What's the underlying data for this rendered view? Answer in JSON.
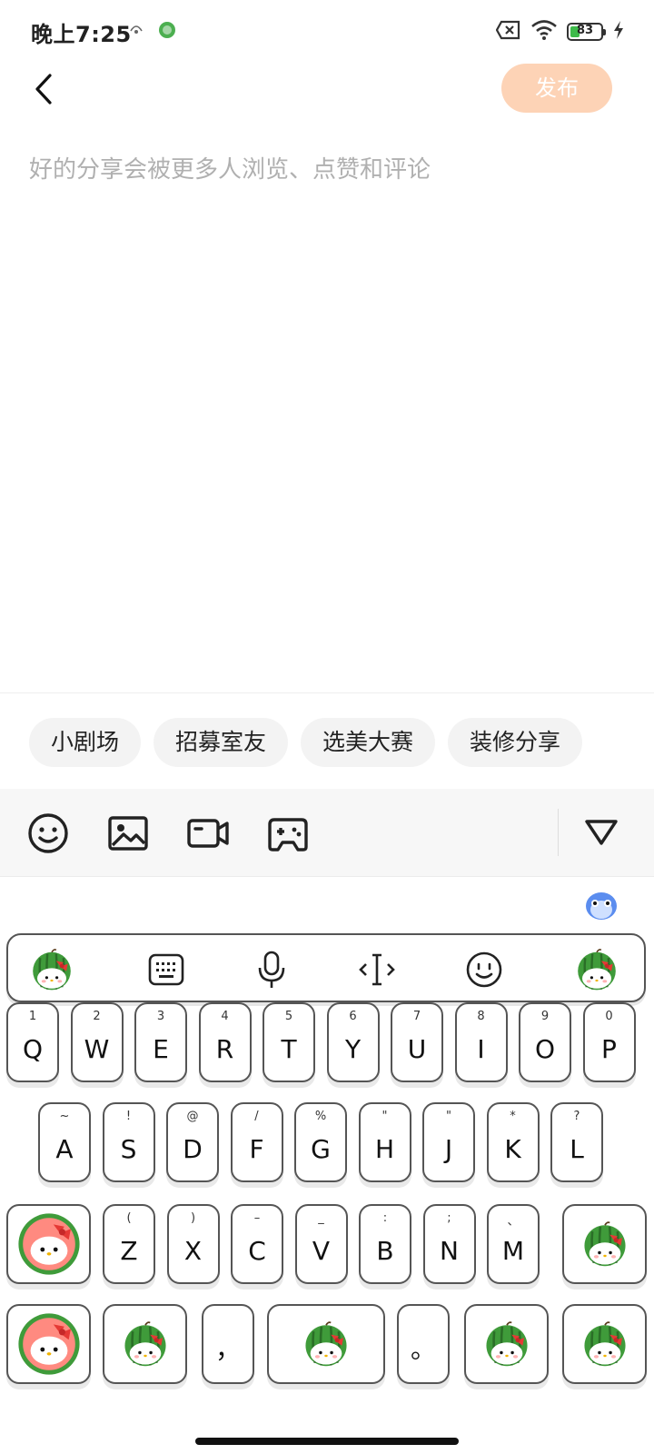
{
  "status_bar": {
    "time": "晚上7:25",
    "battery": "83"
  },
  "header": {
    "publish_label": "发布"
  },
  "editor": {
    "placeholder": "好的分享会被更多人浏览、点赞和评论"
  },
  "topics": [
    "小剧场",
    "招募室友",
    "选美大赛",
    "装修分享"
  ],
  "toolbar": {
    "icons": [
      "emoji-icon",
      "image-icon",
      "video-icon",
      "game-icon",
      "collapse-icon"
    ]
  },
  "keyboard": {
    "row1": [
      {
        "key": "Q",
        "hint": "1"
      },
      {
        "key": "W",
        "hint": "2"
      },
      {
        "key": "E",
        "hint": "3"
      },
      {
        "key": "R",
        "hint": "4"
      },
      {
        "key": "T",
        "hint": "5"
      },
      {
        "key": "Y",
        "hint": "6"
      },
      {
        "key": "U",
        "hint": "7"
      },
      {
        "key": "I",
        "hint": "8"
      },
      {
        "key": "O",
        "hint": "9"
      },
      {
        "key": "P",
        "hint": "0"
      }
    ],
    "row2": [
      {
        "key": "A",
        "hint": "~"
      },
      {
        "key": "S",
        "hint": "!"
      },
      {
        "key": "D",
        "hint": "@"
      },
      {
        "key": "F",
        "hint": "/"
      },
      {
        "key": "G",
        "hint": "%"
      },
      {
        "key": "H",
        "hint": "\""
      },
      {
        "key": "J",
        "hint": "\""
      },
      {
        "key": "K",
        "hint": "*"
      },
      {
        "key": "L",
        "hint": "?"
      }
    ],
    "row3": [
      {
        "key": "Z",
        "hint": "("
      },
      {
        "key": "X",
        "hint": ")"
      },
      {
        "key": "C",
        "hint": "–"
      },
      {
        "key": "V",
        "hint": "_"
      },
      {
        "key": "B",
        "hint": ":"
      },
      {
        "key": "N",
        "hint": ";"
      },
      {
        "key": "M",
        "hint": "、"
      }
    ],
    "comma": "，",
    "period": "。"
  },
  "colors": {
    "publish_bg": "#fdd3b6",
    "placeholder": "#b0b0b0",
    "chip_bg": "#f3f3f3",
    "toolbar_bg": "#f7f7f7"
  }
}
